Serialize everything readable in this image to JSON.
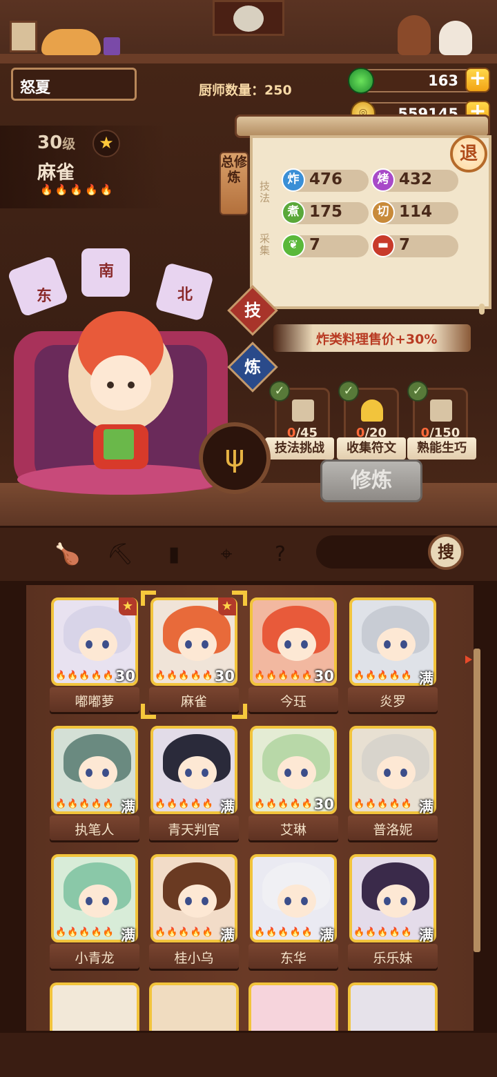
{
  "header": {
    "player_name": "怒夏",
    "chef_count_label": "厨师数量：250",
    "jade_amount": "163",
    "gold_amount": "559145",
    "retreat_label": "退"
  },
  "chef": {
    "level": "30",
    "level_unit": "级",
    "name": "麻雀",
    "flames": "🔥🔥🔥🔥🔥"
  },
  "panel": {
    "total_tag": "总修炼",
    "skill_side": "技法",
    "gather_side": "采集",
    "stats": [
      {
        "icon": "炸",
        "value": "476",
        "color": "#3a8fd6"
      },
      {
        "icon": "烤",
        "value": "432",
        "color": "#a84ac8"
      },
      {
        "icon": "煮",
        "value": "175",
        "color": "#5aa83a"
      },
      {
        "icon": "切",
        "value": "114",
        "color": "#c88a3a"
      },
      {
        "icon": "vegetable-icon",
        "value": "7",
        "color": "#5ab83a"
      },
      {
        "icon": "meat-icon",
        "value": "7",
        "color": "#c83a2a"
      }
    ],
    "tab_skill": "技",
    "tab_train": "炼",
    "bonus_text": "炸类料理售价+30%",
    "tasks": [
      {
        "done": "0",
        "total": "/45",
        "label": "技法挑战"
      },
      {
        "done": "0",
        "total": "/20",
        "label": "收集符文"
      },
      {
        "done": "0",
        "total": "/150",
        "label": "熟能生巧"
      }
    ],
    "train_button": "修炼"
  },
  "filters": {
    "search_label": "搜"
  },
  "cards": [
    {
      "name": "嘟嘟萝",
      "level": "30",
      "starred": true,
      "bg": "#e8e2f0",
      "hair": "#d8d4e8"
    },
    {
      "name": "麻雀",
      "level": "30",
      "starred": true,
      "bg": "#f0e4d8",
      "hair": "#e86a3a"
    },
    {
      "name": "今珏",
      "level": "30",
      "starred": false,
      "bg": "#f2b8a0",
      "hair": "#e85a3a"
    },
    {
      "name": "炎罗",
      "level": "满",
      "starred": false,
      "bg": "#dfe2e8",
      "hair": "#c8ccd4"
    },
    {
      "name": "执笔人",
      "level": "满",
      "starred": false,
      "bg": "#d4e0d6",
      "hair": "#6a8a80"
    },
    {
      "name": "青天判官",
      "level": "满",
      "starred": false,
      "bg": "#e2dce8",
      "hair": "#2a2a3a"
    },
    {
      "name": "艾琳",
      "level": "30",
      "starred": false,
      "bg": "#e4ecd4",
      "hair": "#b8d8a8"
    },
    {
      "name": "普洛妮",
      "level": "满",
      "starred": false,
      "bg": "#e8e0d2",
      "hair": "#d8d4cc"
    },
    {
      "name": "小青龙",
      "level": "满",
      "starred": false,
      "bg": "#d8ecd8",
      "hair": "#8ac8a8"
    },
    {
      "name": "桂小乌",
      "level": "满",
      "starred": false,
      "bg": "#f2dcc8",
      "hair": "#6a3a22"
    },
    {
      "name": "东华",
      "level": "满",
      "starred": false,
      "bg": "#eaeaf2",
      "hair": "#f0f0f4"
    },
    {
      "name": "乐乐妹",
      "level": "满",
      "starred": false,
      "bg": "#e4dcea",
      "hair": "#3a2a4a"
    }
  ]
}
